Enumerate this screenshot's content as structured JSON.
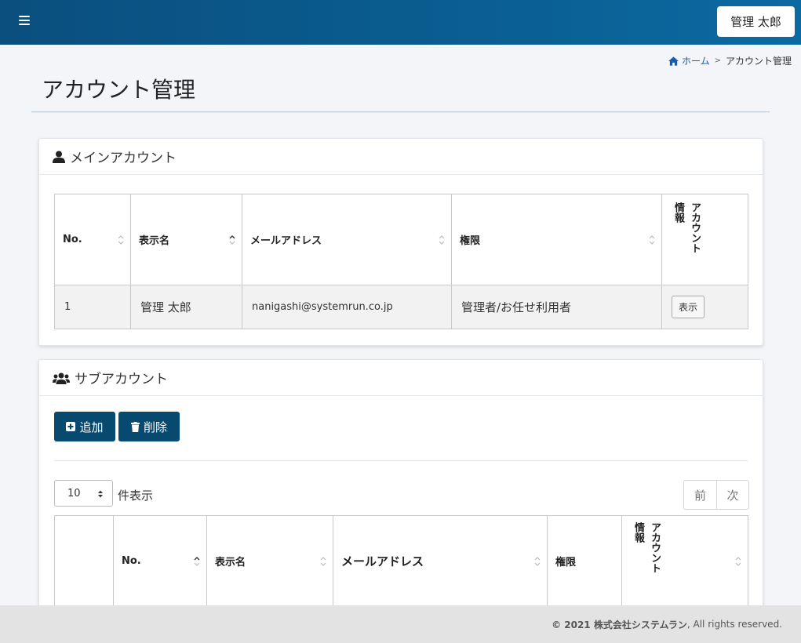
{
  "header": {
    "user_label": "管理 太郎"
  },
  "breadcrumb": {
    "home": "ホーム",
    "separator": ">",
    "current": "アカウント管理"
  },
  "page": {
    "title": "アカウント管理"
  },
  "main_account": {
    "title": "メインアカウント",
    "columns": {
      "no": "No.",
      "name": "表示名",
      "email": "メールアドレス",
      "role": "権限",
      "info": "アカウント情報",
      "info_line1": "アカウント",
      "info_line2": "情報"
    },
    "rows": [
      {
        "no": "1",
        "name": "管理 太郎",
        "email": "nanigashi@systemrun.co.jp",
        "role": "管理者/お任せ利用者",
        "action": "表示"
      }
    ]
  },
  "sub_account": {
    "title": "サブアカウント",
    "add_label": "追加",
    "delete_label": "削除",
    "page_size": "10",
    "per_page_label": "件表示",
    "prev_label": "前",
    "next_label": "次",
    "columns": {
      "no": "No.",
      "name": "表示名",
      "email": "メールアドレス",
      "role": "権限",
      "info_line1": "アカウント",
      "info_line2": "情報"
    }
  },
  "footer": {
    "copyright": "© 2021 株式会社システムラン",
    "rights": ", All rights reserved."
  },
  "colors": {
    "header": "#0a5e92",
    "button": "#08496f",
    "link": "#1c5aa6"
  }
}
